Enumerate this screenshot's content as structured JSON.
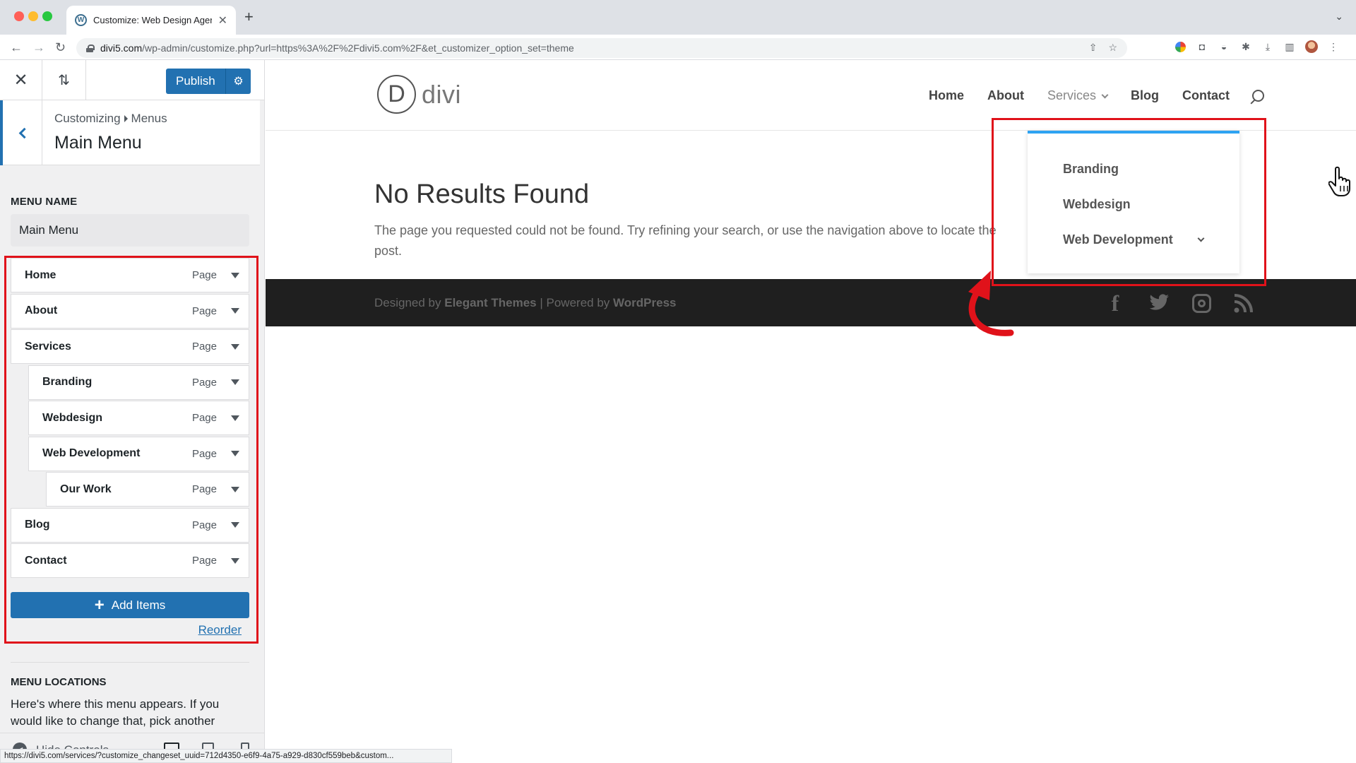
{
  "browser": {
    "tab_title": "Customize: Web Design Agenc",
    "tab_favicon": "W",
    "url_host": "divi5.com",
    "url_path": "/wp-admin/customize.php?url=https%3A%2F%2Fdivi5.com%2F&et_customizer_option_set=theme",
    "status_url": "https://divi5.com/services/?customize_changeset_uuid=712d4350-e6f9-4a75-a929-d830cf559beb&custom..."
  },
  "customizer": {
    "publish_label": "Publish",
    "breadcrumb": [
      "Customizing",
      "Menus"
    ],
    "section_title": "Main Menu",
    "menu_name_label": "MENU NAME",
    "menu_name_value": "Main Menu",
    "menu_items": [
      {
        "title": "Home",
        "type": "Page",
        "depth": 0
      },
      {
        "title": "About",
        "type": "Page",
        "depth": 0
      },
      {
        "title": "Services",
        "type": "Page",
        "depth": 0
      },
      {
        "title": "Branding",
        "type": "Page",
        "depth": 1
      },
      {
        "title": "Webdesign",
        "type": "Page",
        "depth": 1
      },
      {
        "title": "Web Development",
        "type": "Page",
        "depth": 1
      },
      {
        "title": "Our Work",
        "type": "Page",
        "depth": 2
      },
      {
        "title": "Blog",
        "type": "Page",
        "depth": 0
      },
      {
        "title": "Contact",
        "type": "Page",
        "depth": 0
      }
    ],
    "add_items_label": "Add Items",
    "reorder_label": "Reorder",
    "locations_label": "MENU LOCATIONS",
    "locations_desc": "Here's where this menu appears. If you would like to change that, pick another",
    "hide_controls_label": "Hide Controls"
  },
  "site": {
    "logo_letter": "D",
    "logo_text": "divi",
    "nav": [
      "Home",
      "About",
      "Services",
      "Blog",
      "Contact"
    ],
    "active_nav": "Services",
    "dropdown": [
      "Branding",
      "Webdesign",
      "Web Development"
    ],
    "page_title": "No Results Found",
    "page_text": "The page you requested could not be found. Try refining your search, or use the navigation above to locate the post.",
    "footer": {
      "designed_by": "Designed by",
      "designer": "Elegant Themes",
      "separator": "|",
      "powered_by": "Powered by",
      "platform": "WordPress"
    }
  },
  "colors": {
    "accent": "#2271b1",
    "annotation": "#e0121a",
    "dropdown_border": "#2ea3f2",
    "footer_bg": "#1f1f1f"
  },
  "icons": [
    "close-icon",
    "sort-icon",
    "gear-icon",
    "back-chevron-icon",
    "dropdown-arrow-icon",
    "plus-icon",
    "search-icon",
    "facebook-icon",
    "twitter-icon",
    "instagram-icon",
    "rss-icon",
    "pointer-hand-icon",
    "curved-arrow-icon"
  ]
}
